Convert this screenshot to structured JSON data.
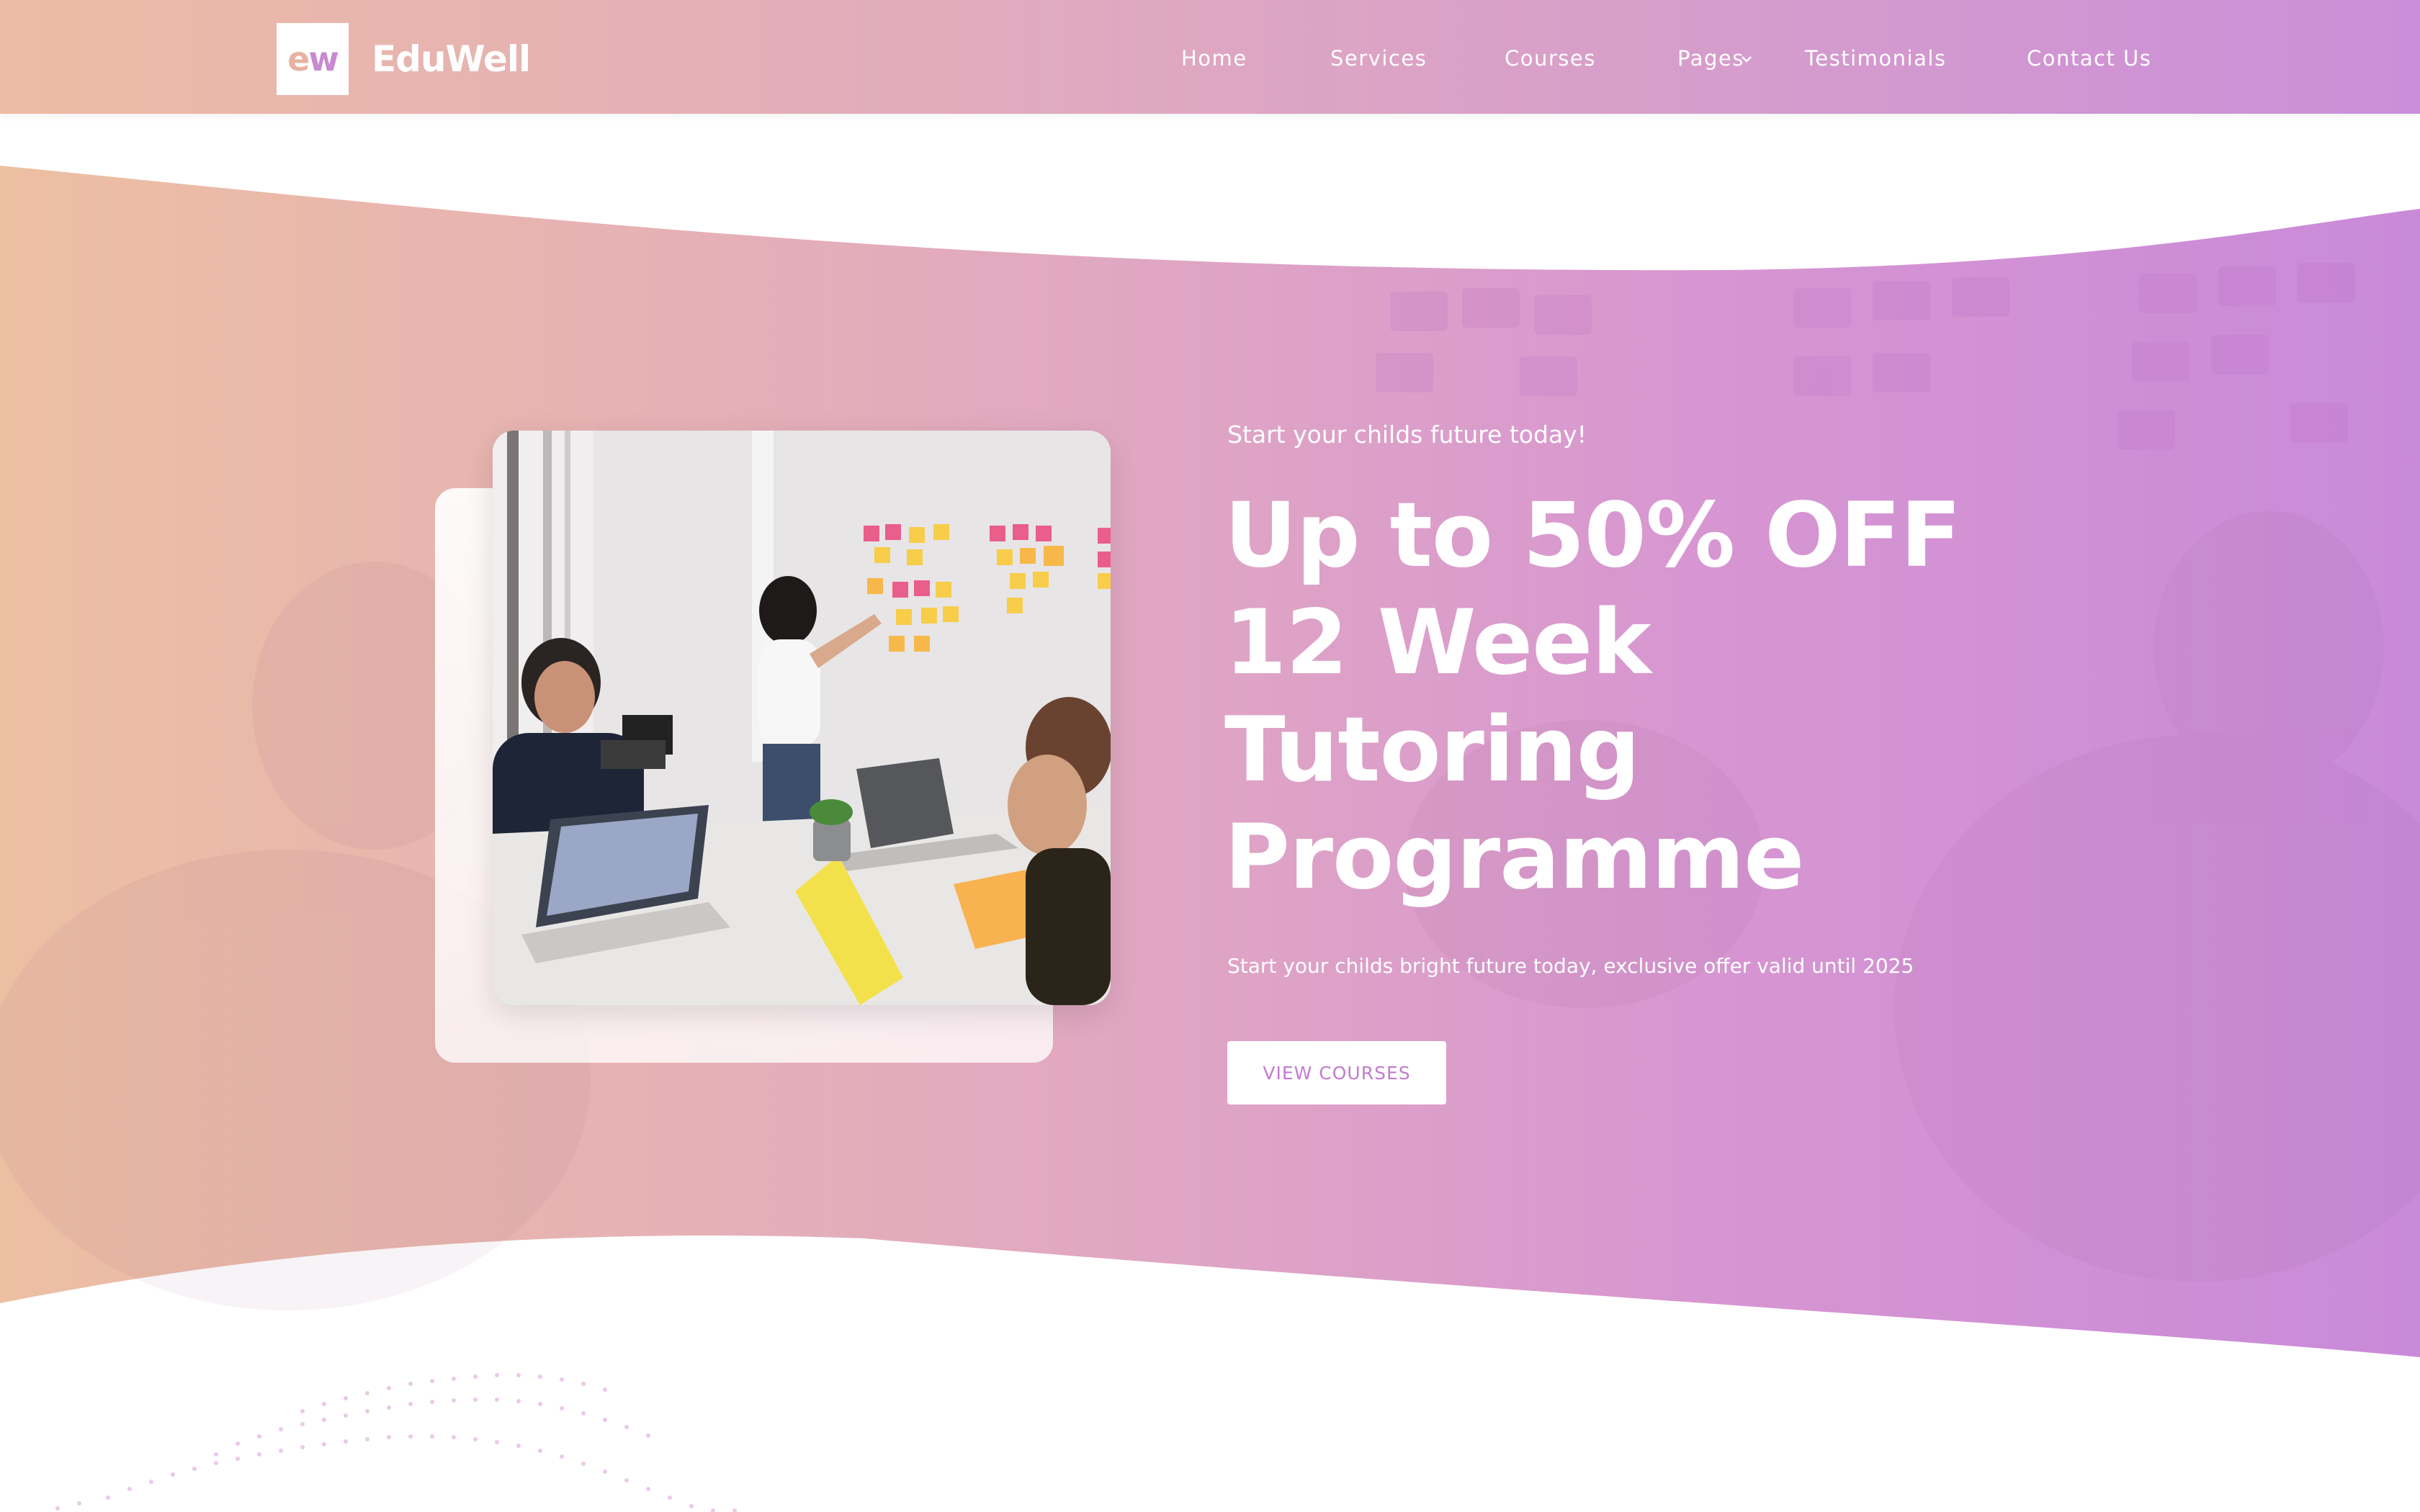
{
  "header": {
    "logo_mark_part1": "e",
    "logo_mark_part2": "w",
    "brand": "EduWell",
    "nav": [
      {
        "label": "Home"
      },
      {
        "label": "Services"
      },
      {
        "label": "Courses"
      },
      {
        "label": "Pages",
        "has_dropdown": true
      },
      {
        "label": "Testimonials"
      },
      {
        "label": "Contact Us"
      }
    ]
  },
  "hero": {
    "tagline": "Start your childs future today!",
    "headline_lines": [
      "Up to 50% OFF",
      "12 Week",
      "Tutoring",
      "Programme"
    ],
    "subtext": "Start your childs bright future today, exclusive offer valid until 2025",
    "cta_label": "VIEW COURSES",
    "image_icon": "classroom-photo"
  },
  "colors": {
    "gradient_start": "#ecbca4",
    "gradient_end": "#c98ad9",
    "cta_text": "#c27bcf",
    "text": "#ffffff"
  }
}
